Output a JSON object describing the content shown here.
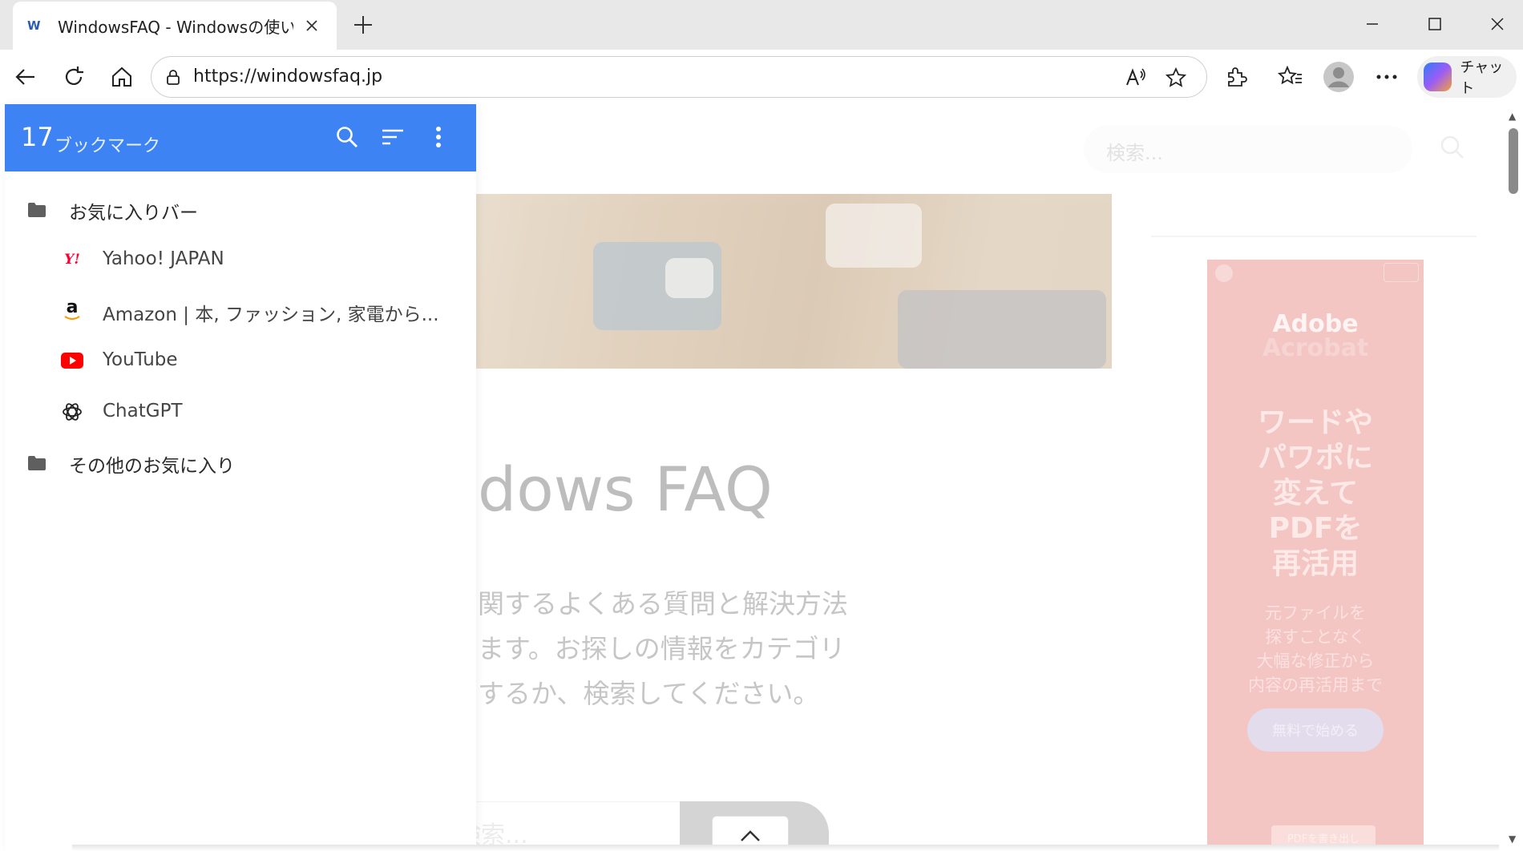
{
  "tab": {
    "favicon_text": "W",
    "title": "WindowsFAQ - Windowsの使い方・"
  },
  "toolbar": {
    "url": "https://windowsfaq.jp",
    "copilot_label": "チャット"
  },
  "bookmarks_panel": {
    "count": "17",
    "title": "ブックマーク",
    "folders": [
      {
        "label": "お気に入りバー"
      },
      {
        "label": "その他のお気に入り"
      }
    ],
    "items": [
      {
        "label": "Yahoo! JAPAN",
        "icon": "yahoo-icon",
        "icon_text": "Y!"
      },
      {
        "label": "Amazon | 本, ファッション, 家電から...",
        "icon": "amazon-icon",
        "icon_text": "a"
      },
      {
        "label": "YouTube",
        "icon": "youtube-icon"
      },
      {
        "label": "ChatGPT",
        "icon": "chatgpt-icon"
      }
    ]
  },
  "page": {
    "search_placeholder": "検索...",
    "site_title": "dows FAQ",
    "description_lines": [
      "関するよくある質問と解決方法",
      "ます。お探しの情報をカテゴリ",
      "するか、検索してください。"
    ],
    "bottom_search_placeholder": "検索..."
  },
  "ad": {
    "brand_line1": "Adobe",
    "brand_line2": "Acrobat",
    "headline": "ワードや\nパワポに\n変えて\nPDFを\n再活用",
    "body": "元ファイルを\n探すことなく\n大幅な修正から\n内容の再活用まで",
    "cta": "無料で始める",
    "small_button": "PDFを書き出し"
  },
  "colors": {
    "accent": "#3d83f3",
    "ad_background": "#f3c6c3"
  }
}
